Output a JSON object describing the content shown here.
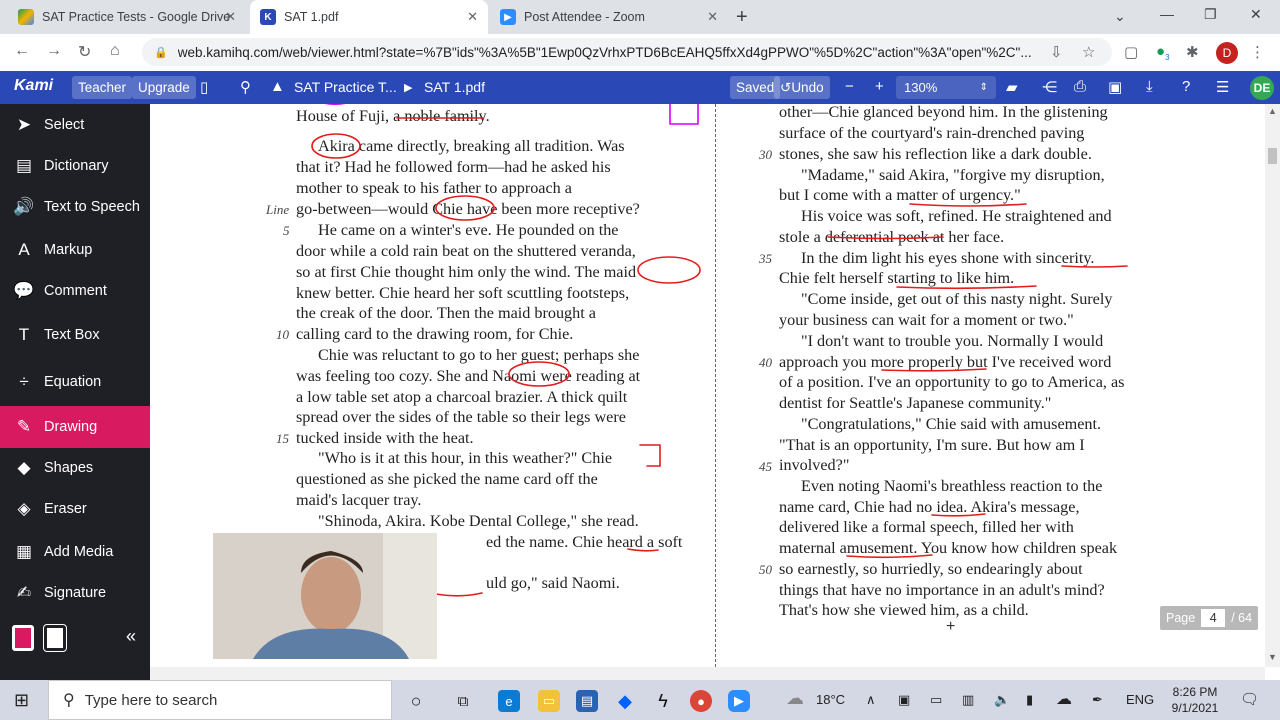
{
  "browser": {
    "tabs": [
      {
        "label": "SAT Practice Tests - Google Drive",
        "active": false
      },
      {
        "label": "SAT 1.pdf",
        "active": true
      },
      {
        "label": "Post Attendee - Zoom",
        "active": false
      }
    ],
    "url": "web.kamihq.com/web/viewer.html?state=%7B\"ids\"%3A%5B\"1Ewp0QzVrhxPTD6BcEAHQ5ffxXd4gPPWO\"%5D%2C\"action\"%3A\"open\"%2C\"...",
    "profile_initial": "D",
    "ext_badge": "3"
  },
  "kami": {
    "logo": "Kami",
    "teacher_label": "Teacher",
    "upgrade_label": "Upgrade",
    "breadcrumb_folder": "SAT Practice T...",
    "breadcrumb_file": "SAT 1.pdf",
    "saved_label": "Saved",
    "undo_label": "Undo",
    "zoom": "130%",
    "avatar": "DE"
  },
  "tools": [
    {
      "label": "Select",
      "icon": "cursor-icon"
    },
    {
      "label": "Dictionary",
      "icon": "book-icon"
    },
    {
      "label": "Text to Speech",
      "icon": "speaker-icon"
    },
    {
      "label": "Markup",
      "icon": "markup-icon"
    },
    {
      "label": "Comment",
      "icon": "comment-icon"
    },
    {
      "label": "Text Box",
      "icon": "textbox-icon"
    },
    {
      "label": "Equation",
      "icon": "equation-icon"
    },
    {
      "label": "Drawing",
      "icon": "pen-icon"
    },
    {
      "label": "Shapes",
      "icon": "shapes-icon"
    },
    {
      "label": "Eraser",
      "icon": "eraser-icon"
    },
    {
      "label": "Add Media",
      "icon": "media-icon"
    },
    {
      "label": "Signature",
      "icon": "signature-icon"
    }
  ],
  "drawing": {
    "stroke_size": "1",
    "colors": [
      "#d500f9",
      "#000000",
      "#ff0000"
    ],
    "collapse": "«"
  },
  "document": {
    "left_lines": [
      "House of Fuji, a noble family.",
      "Akira came directly, breaking all tradition. Was",
      "that it? Had he followed form—had he asked his",
      "mother to speak to his father to approach a",
      "go-between—would Chie have been more receptive?",
      "He came on a winter's eve. He pounded on the",
      "door while a cold rain beat on the shuttered veranda,",
      "so at first Chie thought him only the wind. The maid",
      "knew better. Chie heard her soft scuttling footsteps,",
      "the creak of the door. Then the maid brought a",
      "calling card to the drawing room, for Chie.",
      "Chie was reluctant to go to her guest; perhaps she",
      "was feeling too cozy. She and Naomi were reading at",
      "a low table set atop a charcoal brazier. A thick quilt",
      "spread over the sides of the table so their legs were",
      "tucked inside with the heat.",
      "\"Who is it at this hour, in this weather?\" Chie",
      "questioned as she picked the name card off the",
      "maid's lacquer tray.",
      "\"Shinoda, Akira. Kobe Dental College,\" she read.",
      "ed the name. Chie heard a soft",
      "uld go,\" said Naomi."
    ],
    "left_line_label": "Line",
    "left_line_numbers": [
      "5",
      "10",
      "15"
    ],
    "right_lines": [
      "other—Chie glanced beyond him. In the glistening",
      "surface of the courtyard's rain-drenched paving",
      "stones, she saw his reflection like a dark double.",
      "\"Madame,\" said Akira, \"forgive my disruption,",
      "but I come with a matter of urgency.\"",
      "His voice was soft, refined. He straightened and",
      "stole a deferential peek at her face.",
      "In the dim light his eyes shone with sincerity.",
      "Chie felt herself starting to like him.",
      "\"Come inside, get out of this nasty night. Surely",
      "your business can wait for a moment or two.\"",
      "\"I don't want to trouble you. Normally I would",
      "approach you more properly but I've received word",
      "of a position. I've an opportunity to go to America, as",
      "dentist for Seattle's Japanese community.\"",
      "\"Congratulations,\" Chie said with amusement.",
      "\"That is an opportunity, I'm sure. But how am I",
      "involved?\"",
      "Even noting Naomi's breathless reaction to the",
      "name card, Chie had no idea. Akira's message,",
      "delivered like a formal speech, filled her with",
      "maternal amusement. You know how children speak",
      "so earnestly, so hurriedly, so endearingly about",
      "things that have no importance in an adult's mind?",
      "That's how she viewed him, as a child."
    ],
    "right_line_numbers": [
      "30",
      "35",
      "40",
      "45",
      "50"
    ],
    "page_label": "Page",
    "page_current": "4",
    "page_total": "/ 64"
  },
  "taskbar": {
    "search_placeholder": "Type here to search",
    "weather": "18°C",
    "language": "ENG",
    "time": "8:26 PM",
    "date": "9/1/2021"
  }
}
